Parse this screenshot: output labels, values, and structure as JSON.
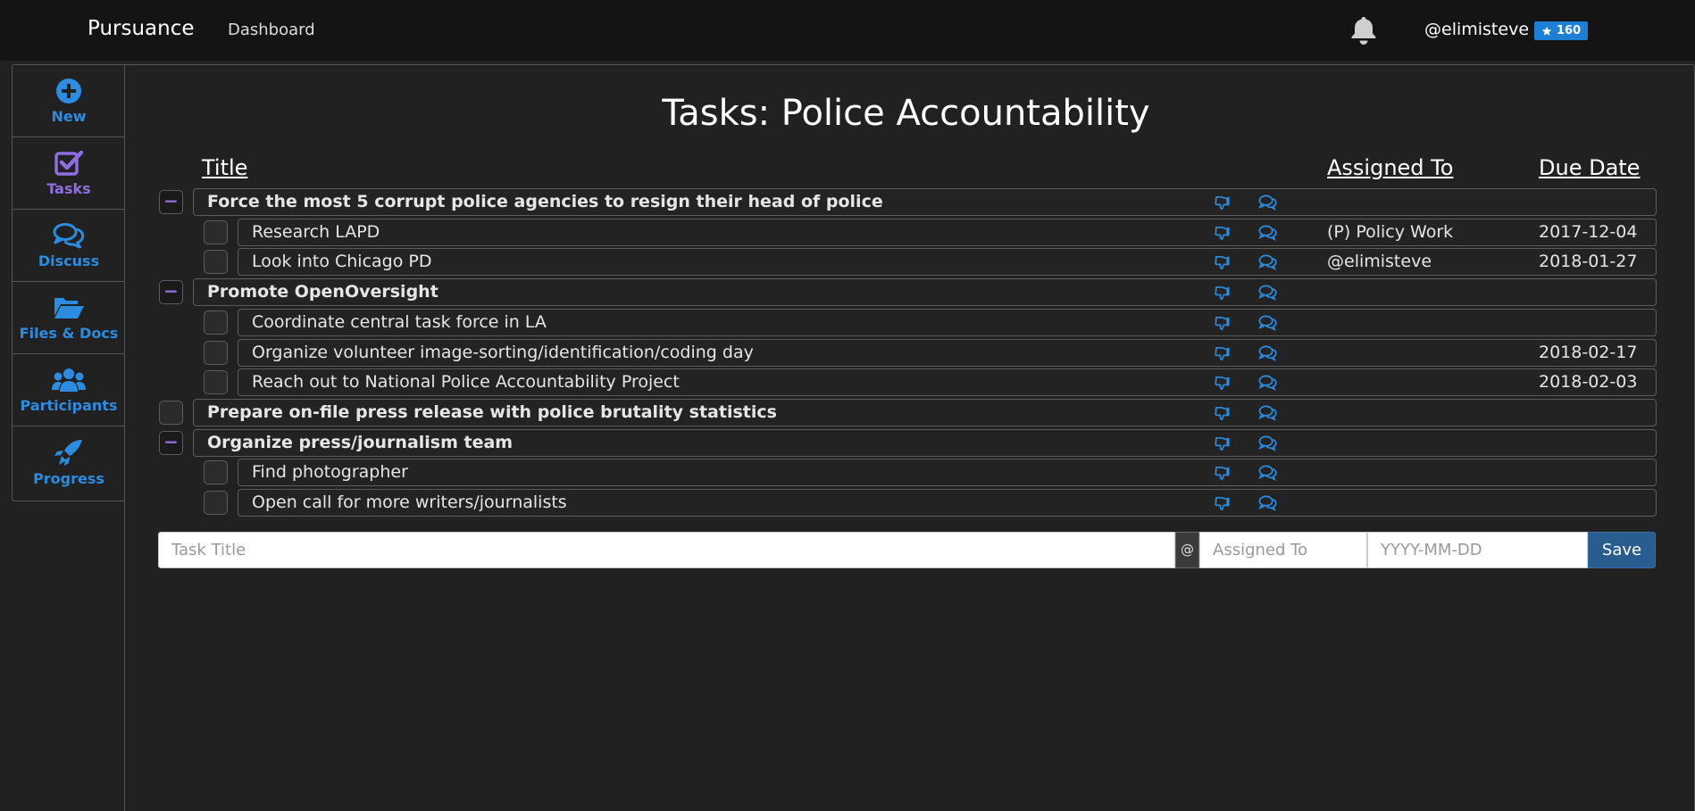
{
  "nav": {
    "brand": "Pursuance",
    "dashboard": "Dashboard",
    "username": "@elimisteve",
    "reputation": "160"
  },
  "sidebar": {
    "items": [
      {
        "label": "New",
        "icon": "plus-circle-icon"
      },
      {
        "label": "Tasks",
        "icon": "checkbox-icon",
        "active": true
      },
      {
        "label": "Discuss",
        "icon": "chat-icon"
      },
      {
        "label": "Files & Docs",
        "icon": "folder-icon"
      },
      {
        "label": "Participants",
        "icon": "users-icon"
      },
      {
        "label": "Progress",
        "icon": "rocket-icon"
      }
    ]
  },
  "page": {
    "title": "Tasks: Police Accountability",
    "col_title": "Title",
    "col_assigned": "Assigned To",
    "col_due": "Due Date"
  },
  "tasks": [
    {
      "title": "Force the most 5 corrupt police agencies to resign their head of police",
      "level": 0,
      "bold": true,
      "toggle": "−",
      "assigned": "",
      "due": ""
    },
    {
      "title": "Research LAPD",
      "level": 1,
      "bold": false,
      "toggle": "",
      "assigned": "(P) Policy Work",
      "due": "2017-12-04"
    },
    {
      "title": "Look into Chicago PD",
      "level": 1,
      "bold": false,
      "toggle": "",
      "assigned": "@elimisteve",
      "due": "2018-01-27"
    },
    {
      "title": "Promote OpenOversight",
      "level": 0,
      "bold": true,
      "toggle": "−",
      "assigned": "",
      "due": ""
    },
    {
      "title": "Coordinate central task force in LA",
      "level": 1,
      "bold": false,
      "toggle": "",
      "assigned": "",
      "due": ""
    },
    {
      "title": "Organize volunteer image-sorting/identification/coding day",
      "level": 1,
      "bold": false,
      "toggle": "",
      "assigned": "",
      "due": "2018-02-17"
    },
    {
      "title": "Reach out to National Police Accountability Project",
      "level": 1,
      "bold": false,
      "toggle": "",
      "assigned": "",
      "due": "2018-02-03"
    },
    {
      "title": "Prepare on-file press release with police brutality statistics",
      "level": 0,
      "bold": true,
      "toggle": "",
      "assigned": "",
      "due": ""
    },
    {
      "title": "Organize press/journalism team",
      "level": 0,
      "bold": true,
      "toggle": "−",
      "assigned": "",
      "due": ""
    },
    {
      "title": "Find photographer",
      "level": 1,
      "bold": false,
      "toggle": "",
      "assigned": "",
      "due": ""
    },
    {
      "title": "Open call for more writers/journalists",
      "level": 1,
      "bold": false,
      "toggle": "",
      "assigned": "",
      "due": ""
    }
  ],
  "form": {
    "title_placeholder": "Task Title",
    "at_symbol": "@",
    "assigned_placeholder": "Assigned To",
    "date_placeholder": "YYYY-MM-DD",
    "save_label": "Save"
  },
  "colors": {
    "accent": "#2b8ce0",
    "active": "#8e6ee0",
    "badge": "#1e7fd6",
    "save": "#2a5d8f"
  }
}
